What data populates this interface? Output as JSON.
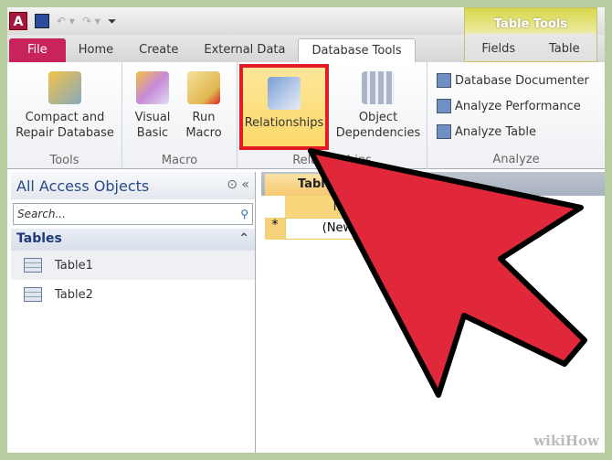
{
  "qat": {
    "app_icon": "A"
  },
  "tabs": {
    "file": "File",
    "home": "Home",
    "create": "Create",
    "external": "External Data",
    "dbtools": "Database Tools",
    "fields": "Fields",
    "table": "Table",
    "tabletools": "Table Tools"
  },
  "ribbon": {
    "compact": "Compact and Repair Database",
    "tools": "Tools",
    "visual_basic": "Visual Basic",
    "run_macro": "Run Macro",
    "macro": "Macro",
    "relationships": "Relationships",
    "object_dependencies": "Object Dependencies",
    "relationships_group": "Relationships",
    "documenter": "Database Documenter",
    "performance": "Analyze Performance",
    "analyze_table": "Analyze Table",
    "analyze": "Analyze"
  },
  "nav": {
    "title": "All Access Objects",
    "search_placeholder": "Search...",
    "section": "Tables",
    "items": [
      "Table1",
      "Table2"
    ]
  },
  "doc": {
    "tab": "Table1",
    "column": "ID",
    "new_row": "*",
    "cell": "(New)"
  },
  "watermark": "wikiHow",
  "colors": {
    "arrow": "#e0283a",
    "highlight": "#e21b24",
    "file_tab": "#c8245b"
  }
}
